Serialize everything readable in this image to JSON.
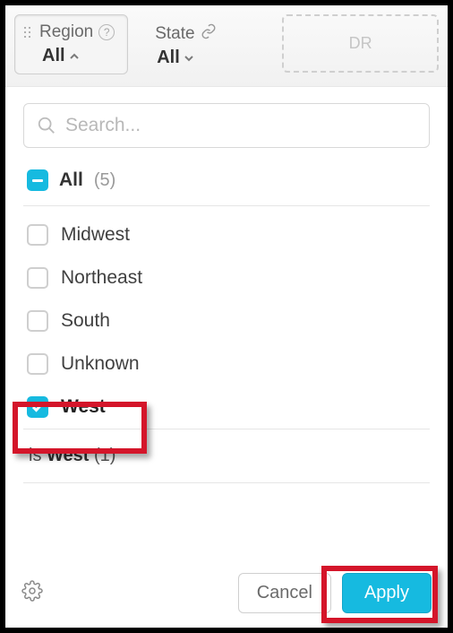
{
  "filters": [
    {
      "label": "Region",
      "value": "All",
      "active": true,
      "icon": "help"
    },
    {
      "label": "State",
      "value": "All",
      "active": false,
      "icon": "link"
    }
  ],
  "dropzone_text": "DR",
  "search": {
    "placeholder": "Search..."
  },
  "all": {
    "label": "All",
    "count": "(5)"
  },
  "options": [
    {
      "label": "Midwest",
      "checked": false
    },
    {
      "label": "Northeast",
      "checked": false
    },
    {
      "label": "South",
      "checked": false
    },
    {
      "label": "Unknown",
      "checked": false
    },
    {
      "label": "West",
      "checked": true
    }
  ],
  "summary": {
    "prefix": "is ",
    "value": "West",
    "count": " (1)"
  },
  "buttons": {
    "cancel": "Cancel",
    "apply": "Apply"
  }
}
